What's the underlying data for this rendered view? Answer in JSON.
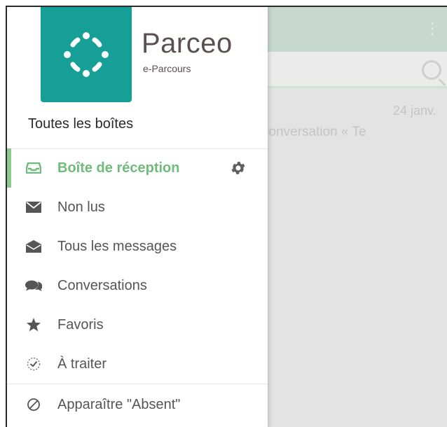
{
  "brand": {
    "name": "Parceo",
    "subtitle": "e-Parcours",
    "tile_color": "#169f96"
  },
  "background": {
    "date": "24 janv.",
    "snippet": "conversation « Te",
    "more_icon": "more-vert-icon",
    "search_icon": "search-icon"
  },
  "drawer": {
    "all_boxes_label": "Toutes les boîtes",
    "items": [
      {
        "label": "Boîte de réception",
        "icon": "inbox-icon",
        "active": true
      },
      {
        "label": "Non lus",
        "icon": "envelope-icon"
      },
      {
        "label": "Tous les messages",
        "icon": "envelope-open-icon"
      },
      {
        "label": "Conversations",
        "icon": "chat-bubbles-icon"
      },
      {
        "label": "Favoris",
        "icon": "star-icon"
      },
      {
        "label": "À traiter",
        "icon": "check-circle-icon"
      }
    ],
    "settings_icon": "gear-icon",
    "absent_label": "Apparaître \"Absent\"",
    "absent_icon": "block-icon",
    "accent_color": "#6fbb7a"
  }
}
